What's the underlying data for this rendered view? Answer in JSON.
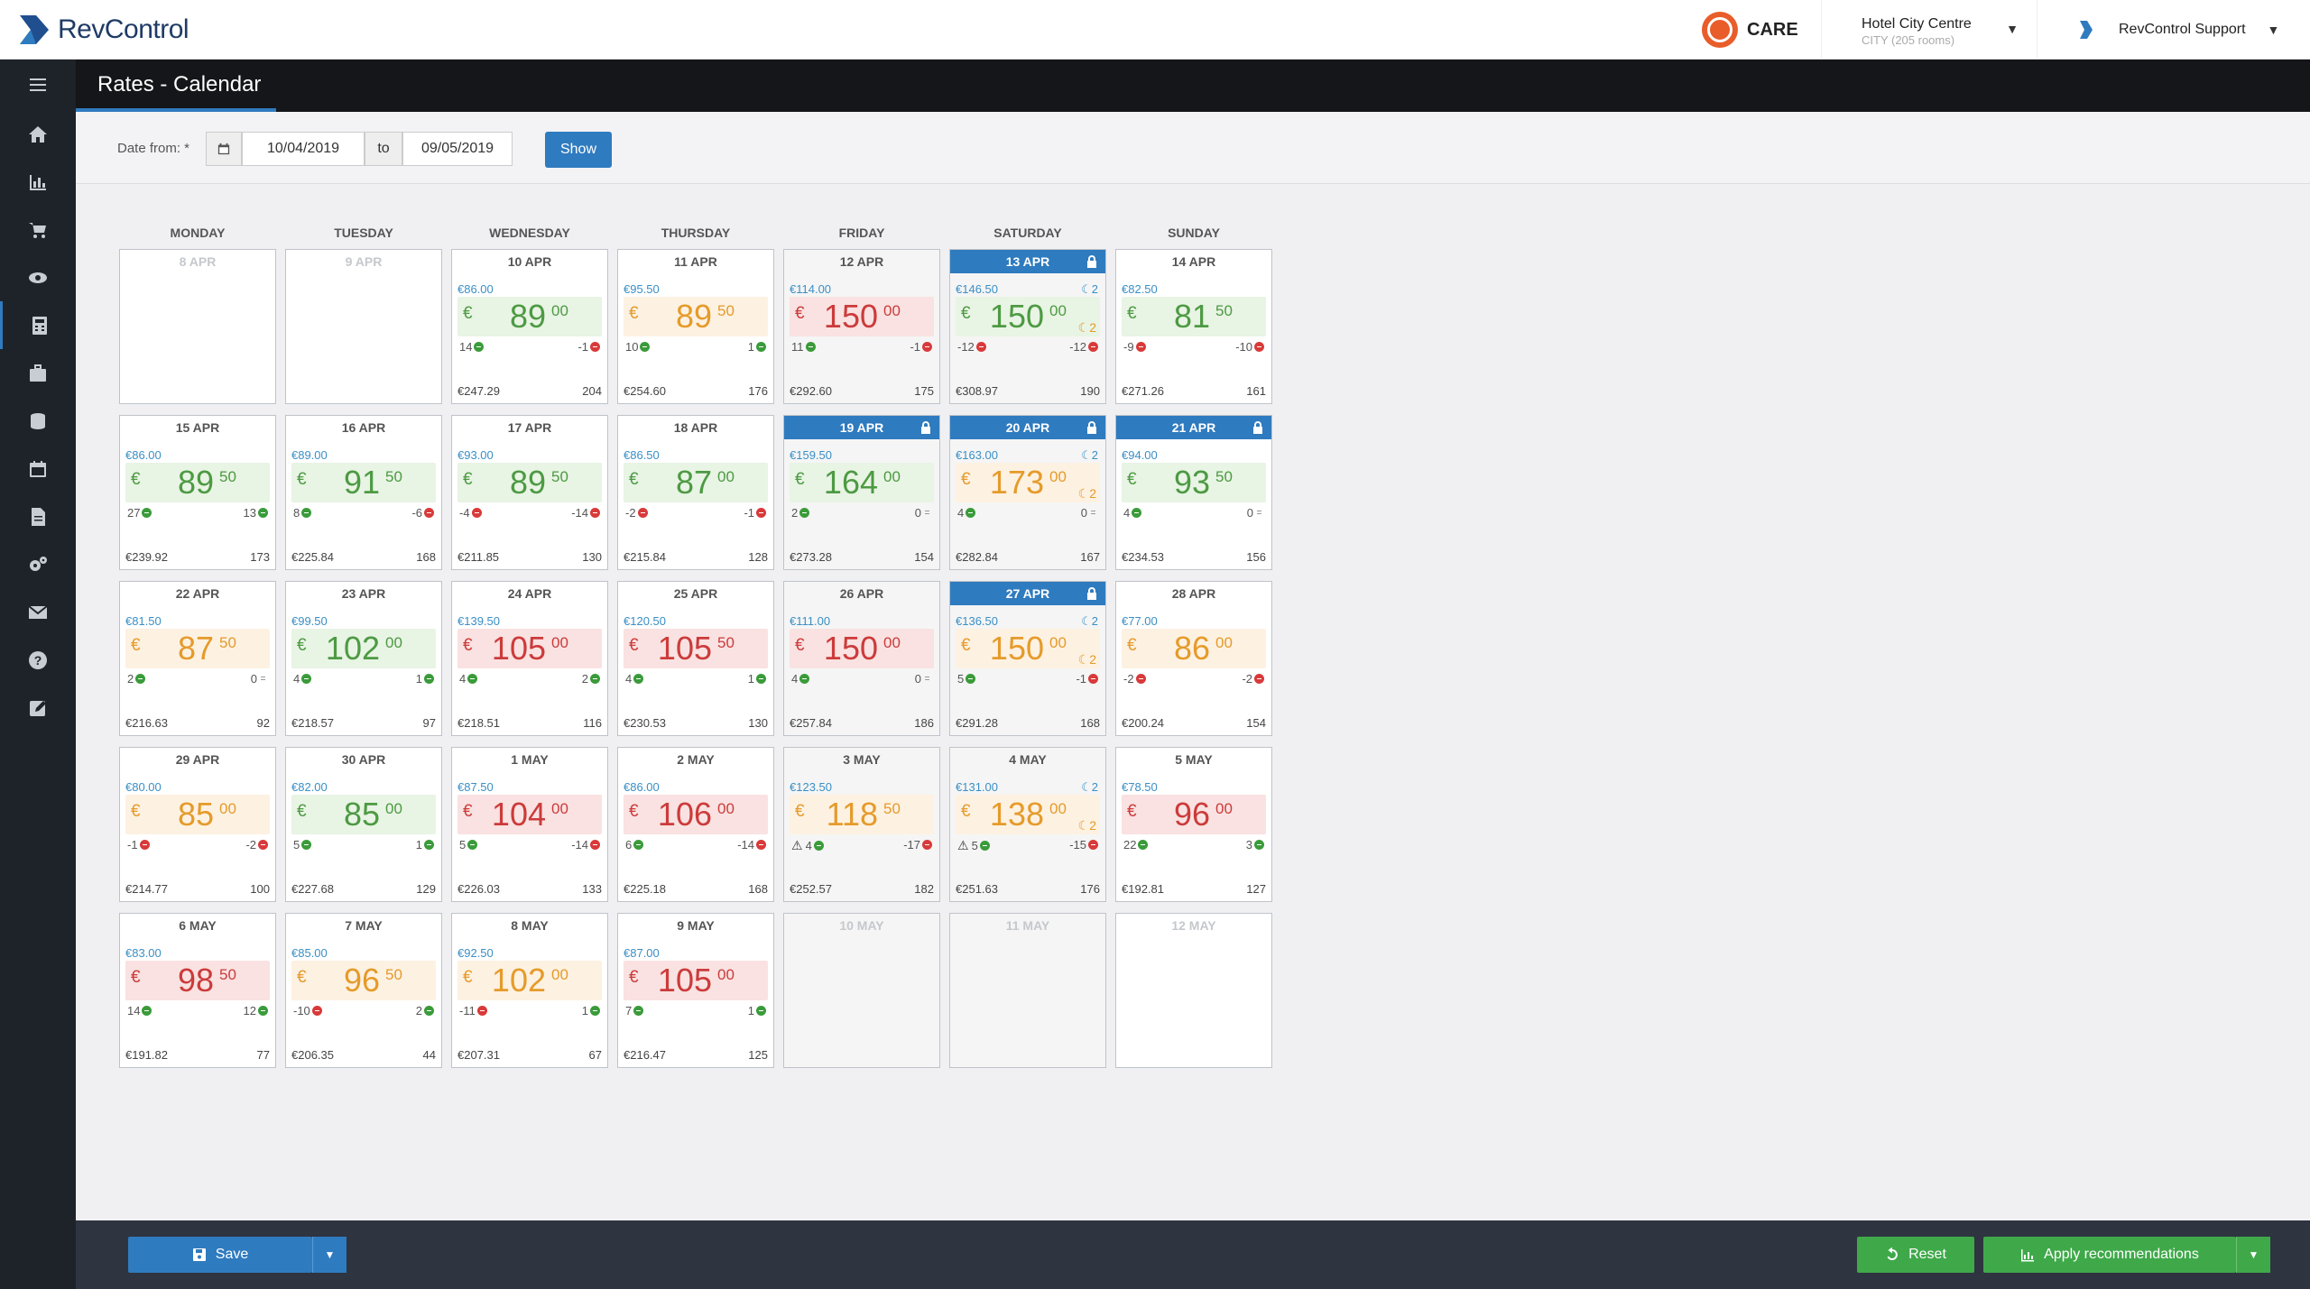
{
  "app": {
    "logo_text": "RevControl",
    "care_label": "CARE"
  },
  "hotel": {
    "name": "Hotel City Centre",
    "sub": "CITY (205 rooms)"
  },
  "user": {
    "name": "RevControl Support"
  },
  "page": {
    "title": "Rates - Calendar"
  },
  "filter": {
    "label": "Date from: *",
    "from": "10/04/2019",
    "to_label": "to",
    "until": "09/05/2019",
    "show": "Show"
  },
  "weekdays": [
    "MONDAY",
    "TUESDAY",
    "WEDNESDAY",
    "THURSDAY",
    "FRIDAY",
    "SATURDAY",
    "SUNDAY"
  ],
  "sidebar_icons": [
    "home-icon",
    "chart-icon",
    "cart-icon",
    "eye-icon",
    "calculator-icon",
    "briefcase-icon",
    "database-icon",
    "calendar-icon",
    "document-icon",
    "settings-icon",
    "mail-icon",
    "help-icon",
    "edit-icon"
  ],
  "colors": {
    "accent": "#2f7bbf",
    "green": "#4d9a43",
    "orange": "#e59b2a",
    "red": "#cc3b3b",
    "success": "#3fa94a"
  },
  "weeks": [
    [
      {
        "date": "8 APR",
        "empty": true
      },
      {
        "date": "9 APR",
        "empty": true
      },
      {
        "date": "10 APR",
        "base": "€86.00",
        "cur": "€",
        "int": "89",
        "dec": "00",
        "tone": "g",
        "left": "14",
        "left_dir": "up",
        "right": "-1",
        "right_dir": "down",
        "revenue": "€247.29",
        "occ": "204"
      },
      {
        "date": "11 APR",
        "base": "€95.50",
        "cur": "€",
        "int": "89",
        "dec": "50",
        "tone": "o",
        "left": "10",
        "left_dir": "up",
        "right": "1",
        "right_dir": "up",
        "revenue": "€254.60",
        "occ": "176"
      },
      {
        "date": "12 APR",
        "grey": true,
        "base": "€114.00",
        "cur": "€",
        "int": "150",
        "dec": "00",
        "tone": "r",
        "left": "11",
        "left_dir": "up",
        "right": "-1",
        "right_dir": "down",
        "revenue": "€292.60",
        "occ": "175"
      },
      {
        "date": "13 APR",
        "grey": true,
        "lock": true,
        "base": "€146.50",
        "comp": "2",
        "moon": "2",
        "cur": "€",
        "int": "150",
        "dec": "00",
        "tone": "g",
        "left": "-12",
        "left_dir": "down",
        "right": "-12",
        "right_dir": "down",
        "revenue": "€308.97",
        "occ": "190"
      },
      {
        "date": "14 APR",
        "base": "€82.50",
        "cur": "€",
        "int": "81",
        "dec": "50",
        "tone": "g",
        "left": "-9",
        "left_dir": "down",
        "right": "-10",
        "right_dir": "down",
        "revenue": "€271.26",
        "occ": "161"
      }
    ],
    [
      {
        "date": "15 APR",
        "base": "€86.00",
        "cur": "€",
        "int": "89",
        "dec": "50",
        "tone": "g",
        "left": "27",
        "left_dir": "up",
        "right": "13",
        "right_dir": "up",
        "revenue": "€239.92",
        "occ": "173"
      },
      {
        "date": "16 APR",
        "base": "€89.00",
        "cur": "€",
        "int": "91",
        "dec": "50",
        "tone": "g",
        "left": "8",
        "left_dir": "up",
        "right": "-6",
        "right_dir": "down",
        "revenue": "€225.84",
        "occ": "168"
      },
      {
        "date": "17 APR",
        "base": "€93.00",
        "cur": "€",
        "int": "89",
        "dec": "50",
        "tone": "g",
        "left": "-4",
        "left_dir": "down",
        "right": "-14",
        "right_dir": "down",
        "revenue": "€211.85",
        "occ": "130"
      },
      {
        "date": "18 APR",
        "base": "€86.50",
        "cur": "€",
        "int": "87",
        "dec": "00",
        "tone": "g",
        "left": "-2",
        "left_dir": "down",
        "right": "-1",
        "right_dir": "down",
        "revenue": "€215.84",
        "occ": "128"
      },
      {
        "date": "19 APR",
        "grey": true,
        "lock": true,
        "base": "€159.50",
        "cur": "€",
        "int": "164",
        "dec": "00",
        "tone": "g",
        "left": "2",
        "left_dir": "up",
        "right": "0",
        "right_dir": "eq",
        "revenue": "€273.28",
        "occ": "154"
      },
      {
        "date": "20 APR",
        "grey": true,
        "lock": true,
        "base": "€163.00",
        "comp": "2",
        "moon": "2",
        "cur": "€",
        "int": "173",
        "dec": "00",
        "tone": "o",
        "left": "4",
        "left_dir": "up",
        "right": "0",
        "right_dir": "eq",
        "revenue": "€282.84",
        "occ": "167"
      },
      {
        "date": "21 APR",
        "lock": true,
        "base": "€94.00",
        "cur": "€",
        "int": "93",
        "dec": "50",
        "tone": "g",
        "left": "4",
        "left_dir": "up",
        "right": "0",
        "right_dir": "eq",
        "revenue": "€234.53",
        "occ": "156"
      }
    ],
    [
      {
        "date": "22 APR",
        "base": "€81.50",
        "cur": "€",
        "int": "87",
        "dec": "50",
        "tone": "o",
        "left": "2",
        "left_dir": "up",
        "right": "0",
        "right_dir": "eq",
        "revenue": "€216.63",
        "occ": "92"
      },
      {
        "date": "23 APR",
        "base": "€99.50",
        "cur": "€",
        "int": "102",
        "dec": "00",
        "tone": "g",
        "left": "4",
        "left_dir": "up",
        "right": "1",
        "right_dir": "up",
        "revenue": "€218.57",
        "occ": "97"
      },
      {
        "date": "24 APR",
        "base": "€139.50",
        "cur": "€",
        "int": "105",
        "dec": "00",
        "tone": "r",
        "left": "4",
        "left_dir": "up",
        "right": "2",
        "right_dir": "up",
        "revenue": "€218.51",
        "occ": "116"
      },
      {
        "date": "25 APR",
        "base": "€120.50",
        "cur": "€",
        "int": "105",
        "dec": "50",
        "tone": "r",
        "left": "4",
        "left_dir": "up",
        "right": "1",
        "right_dir": "up",
        "revenue": "€230.53",
        "occ": "130"
      },
      {
        "date": "26 APR",
        "grey": true,
        "base": "€111.00",
        "cur": "€",
        "int": "150",
        "dec": "00",
        "tone": "r",
        "left": "4",
        "left_dir": "up",
        "right": "0",
        "right_dir": "eq",
        "revenue": "€257.84",
        "occ": "186"
      },
      {
        "date": "27 APR",
        "grey": true,
        "lock": true,
        "base": "€136.50",
        "comp": "2",
        "moon": "2",
        "cur": "€",
        "int": "150",
        "dec": "00",
        "tone": "o",
        "left": "5",
        "left_dir": "up",
        "right": "-1",
        "right_dir": "down",
        "revenue": "€291.28",
        "occ": "168"
      },
      {
        "date": "28 APR",
        "base": "€77.00",
        "cur": "€",
        "int": "86",
        "dec": "00",
        "tone": "o",
        "left": "-2",
        "left_dir": "down",
        "right": "-2",
        "right_dir": "down",
        "revenue": "€200.24",
        "occ": "154"
      }
    ],
    [
      {
        "date": "29 APR",
        "base": "€80.00",
        "cur": "€",
        "int": "85",
        "dec": "00",
        "tone": "o",
        "left": "-1",
        "left_dir": "down",
        "right": "-2",
        "right_dir": "down",
        "revenue": "€214.77",
        "occ": "100"
      },
      {
        "date": "30 APR",
        "base": "€82.00",
        "cur": "€",
        "int": "85",
        "dec": "00",
        "tone": "g",
        "left": "5",
        "left_dir": "up",
        "right": "1",
        "right_dir": "up",
        "revenue": "€227.68",
        "occ": "129"
      },
      {
        "date": "1 MAY",
        "base": "€87.50",
        "cur": "€",
        "int": "104",
        "dec": "00",
        "tone": "r",
        "left": "5",
        "left_dir": "up",
        "right": "-14",
        "right_dir": "down",
        "revenue": "€226.03",
        "occ": "133"
      },
      {
        "date": "2 MAY",
        "base": "€86.00",
        "cur": "€",
        "int": "106",
        "dec": "00",
        "tone": "r",
        "left": "6",
        "left_dir": "up",
        "right": "-14",
        "right_dir": "down",
        "revenue": "€225.18",
        "occ": "168"
      },
      {
        "date": "3 MAY",
        "grey": true,
        "base": "€123.50",
        "cur": "€",
        "int": "118",
        "dec": "50",
        "tone": "o",
        "warn": true,
        "left": "4",
        "left_dir": "up",
        "right": "-17",
        "right_dir": "down",
        "revenue": "€252.57",
        "occ": "182"
      },
      {
        "date": "4 MAY",
        "grey": true,
        "base": "€131.00",
        "comp": "2",
        "moon": "2",
        "cur": "€",
        "int": "138",
        "dec": "00",
        "tone": "o",
        "warn": true,
        "left": "5",
        "left_dir": "up",
        "right": "-15",
        "right_dir": "down",
        "revenue": "€251.63",
        "occ": "176"
      },
      {
        "date": "5 MAY",
        "base": "€78.50",
        "cur": "€",
        "int": "96",
        "dec": "00",
        "tone": "r",
        "left": "22",
        "left_dir": "up",
        "right": "3",
        "right_dir": "up",
        "revenue": "€192.81",
        "occ": "127"
      }
    ],
    [
      {
        "date": "6 MAY",
        "base": "€83.00",
        "cur": "€",
        "int": "98",
        "dec": "50",
        "tone": "r",
        "left": "14",
        "left_dir": "up",
        "right": "12",
        "right_dir": "up",
        "revenue": "€191.82",
        "occ": "77"
      },
      {
        "date": "7 MAY",
        "base": "€85.00",
        "cur": "€",
        "int": "96",
        "dec": "50",
        "tone": "o",
        "left": "-10",
        "left_dir": "down",
        "right": "2",
        "right_dir": "up",
        "revenue": "€206.35",
        "occ": "44"
      },
      {
        "date": "8 MAY",
        "base": "€92.50",
        "cur": "€",
        "int": "102",
        "dec": "00",
        "tone": "o",
        "left": "-11",
        "left_dir": "down",
        "right": "1",
        "right_dir": "up",
        "revenue": "€207.31",
        "occ": "67"
      },
      {
        "date": "9 MAY",
        "base": "€87.00",
        "cur": "€",
        "int": "105",
        "dec": "00",
        "tone": "r",
        "left": "7",
        "left_dir": "up",
        "right": "1",
        "right_dir": "up",
        "revenue": "€216.47",
        "occ": "125"
      },
      {
        "date": "10 MAY",
        "empty": true,
        "grey": true
      },
      {
        "date": "11 MAY",
        "empty": true,
        "grey": true
      },
      {
        "date": "12 MAY",
        "empty": true
      }
    ]
  ],
  "footer": {
    "save": "Save",
    "reset": "Reset",
    "apply": "Apply recommendations"
  }
}
